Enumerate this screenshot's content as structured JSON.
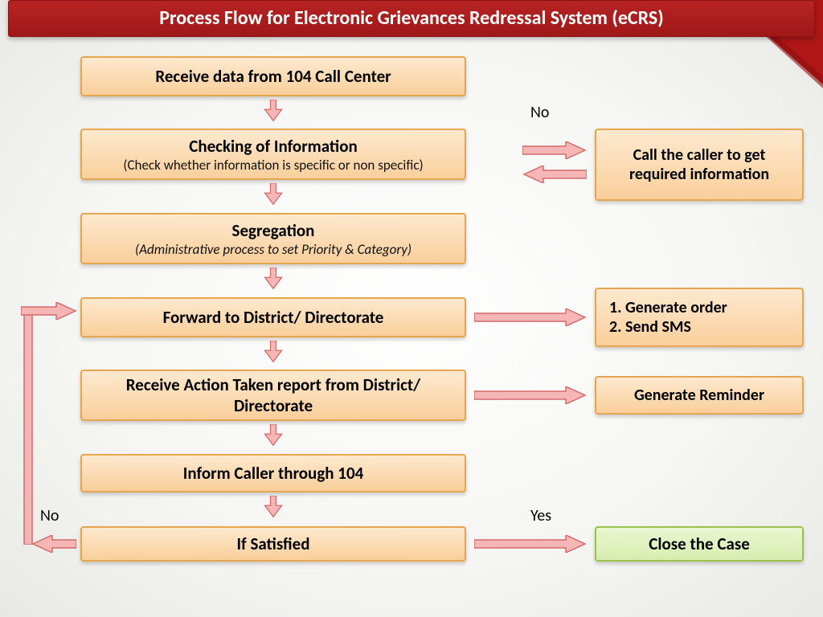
{
  "title": "Process Flow for Electronic Grievances Redressal System (eCRS)",
  "steps": {
    "receive": "Receive data from 104 Call Center",
    "check_main": "Checking of Information",
    "check_sub": "(Check whether information is specific or non specific)",
    "call_back": "Call the caller to get required information",
    "segregation_main": "Segregation",
    "segregation_sub": "(Administrative process to set Priority & Category)",
    "forward": "Forward to District/ Directorate",
    "gen_order": "Generate order",
    "send_sms": "Send SMS",
    "receive_atr": "Receive Action Taken report from District/ Directorate",
    "reminder": "Generate Reminder",
    "inform": "Inform Caller through 104",
    "satisfied": "If Satisfied",
    "close": "Close the Case"
  },
  "labels": {
    "no_top": "No",
    "no_bottom": "No",
    "yes": "Yes"
  }
}
